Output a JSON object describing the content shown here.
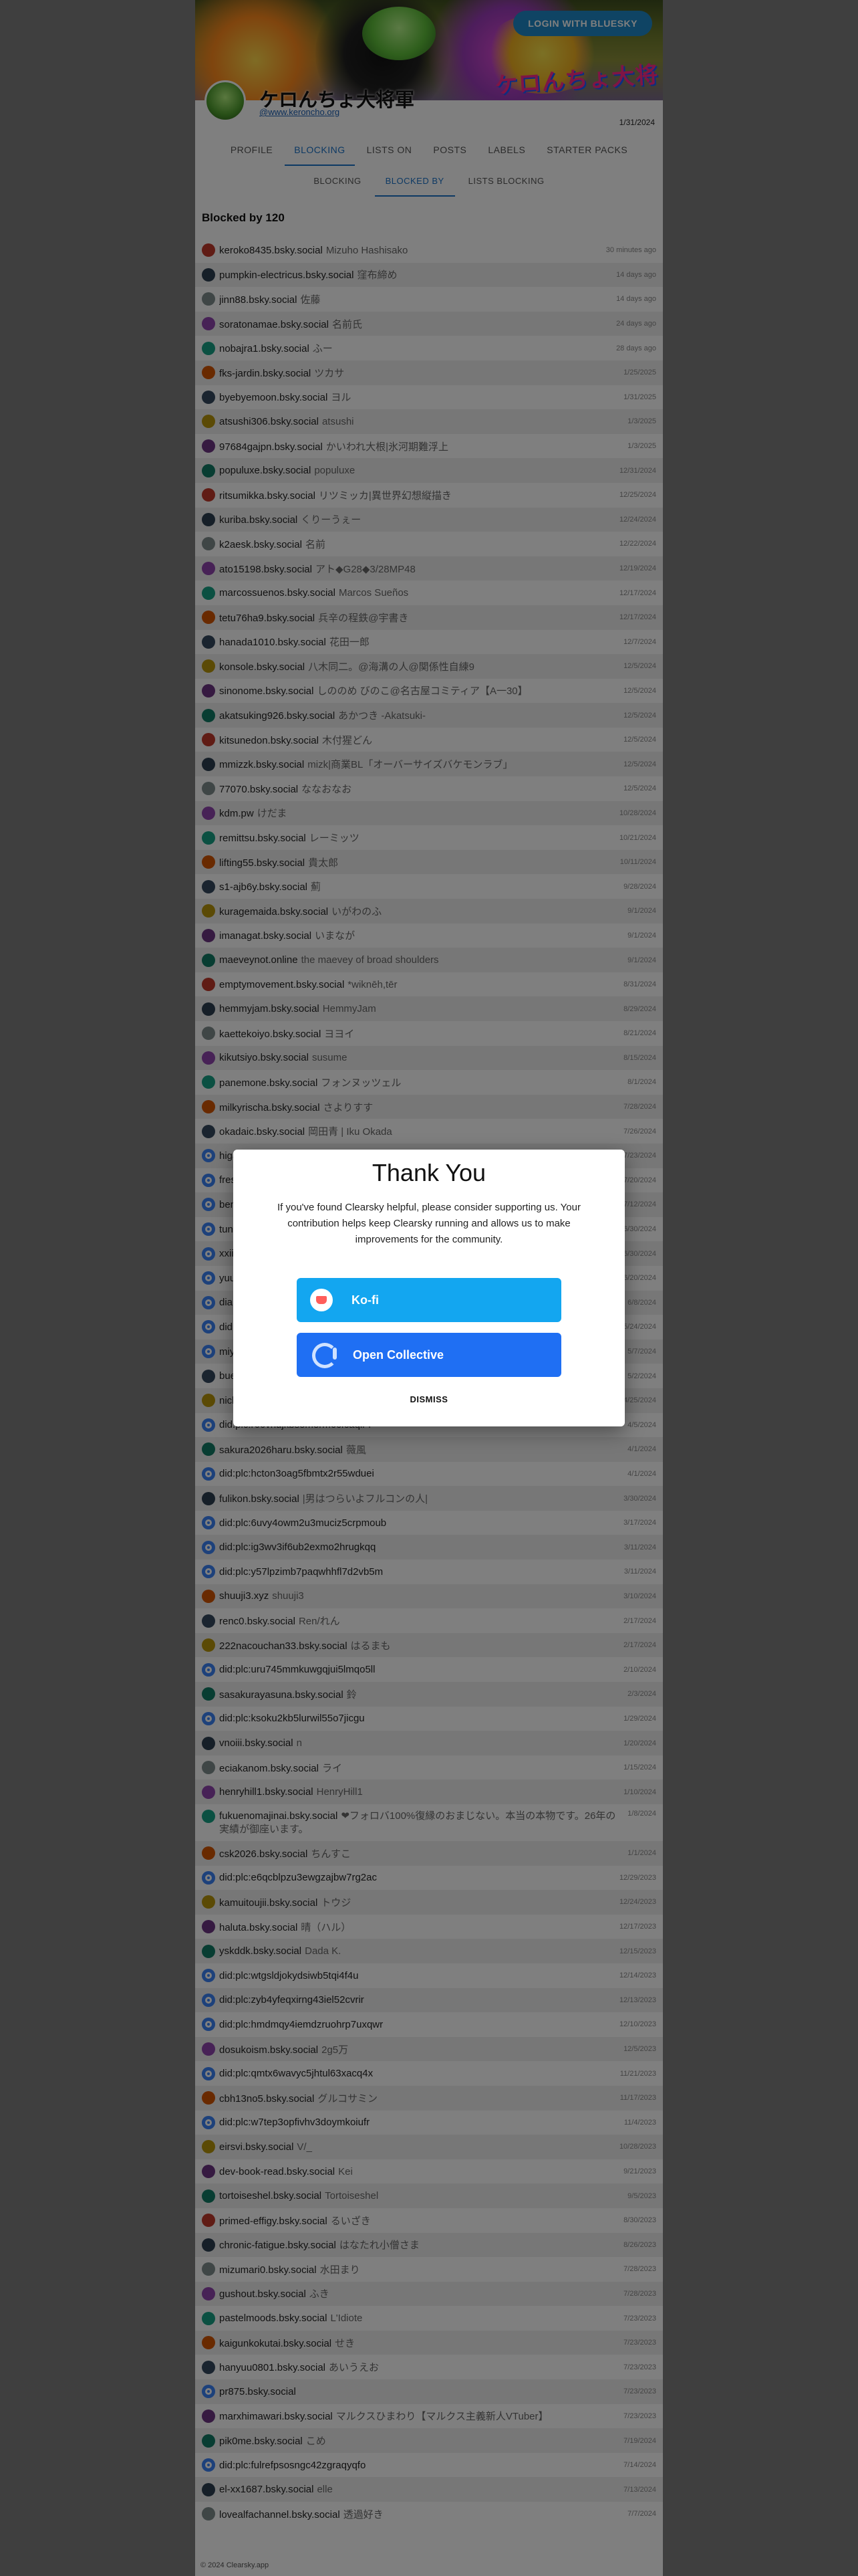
{
  "header": {
    "login_label": "LOGIN WITH BLUESKY",
    "banner_text": "ケロんちょ大将軍"
  },
  "profile": {
    "display_name": "ケロんちょ大将軍",
    "handle": "@www.keroncho.org",
    "joined": "1/31/2024"
  },
  "tabs": [
    "PROFILE",
    "BLOCKING",
    "LISTS ON",
    "POSTS",
    "LABELS",
    "STARTER PACKS"
  ],
  "active_tab": "BLOCKING",
  "subtabs": [
    "BLOCKING",
    "BLOCKED BY",
    "LISTS BLOCKING"
  ],
  "active_subtab": "BLOCKED BY",
  "list_title": "Blocked by 120",
  "rows": [
    {
      "handle": "keroko8435.bsky.social",
      "name": "Mizuho Hashisako",
      "date": "30 minutes ago"
    },
    {
      "handle": "pumpkin-electricus.bsky.social",
      "name": "窪布締め",
      "date": "14 days ago"
    },
    {
      "handle": "jinn88.bsky.social",
      "name": "佐藤",
      "date": "14 days ago"
    },
    {
      "handle": "soratonamae.bsky.social",
      "name": "名前氏",
      "date": "24 days ago"
    },
    {
      "handle": "nobajra1.bsky.social",
      "name": "ふー",
      "date": "28 days ago"
    },
    {
      "handle": "fks-jardin.bsky.social",
      "name": "ツカサ",
      "date": "1/25/2025"
    },
    {
      "handle": "byebyemoon.bsky.social",
      "name": "ヨル",
      "date": "1/31/2025"
    },
    {
      "handle": "atsushi306.bsky.social",
      "name": "atsushi",
      "date": "1/3/2025"
    },
    {
      "handle": "97684gajpn.bsky.social",
      "name": "かいわれ大根|氷河期難浮上",
      "date": "1/3/2025"
    },
    {
      "handle": "populuxe.bsky.social",
      "name": "populuxe",
      "date": "12/31/2024"
    },
    {
      "handle": "ritsumikka.bsky.social",
      "name": "リツミッカ|異世界幻想縦描き",
      "date": "12/25/2024"
    },
    {
      "handle": "kuriba.bsky.social",
      "name": "くりーうぇー",
      "date": "12/24/2024"
    },
    {
      "handle": "k2aesk.bsky.social",
      "name": "名前",
      "date": "12/22/2024"
    },
    {
      "handle": "ato15198.bsky.social",
      "name": "アト◆G28◆3/28MP48",
      "date": "12/19/2024"
    },
    {
      "handle": "marcossuenos.bsky.social",
      "name": "Marcos Sueños",
      "date": "12/17/2024"
    },
    {
      "handle": "tetu76ha9.bsky.social",
      "name": "兵辛の程鉄@宇書き",
      "date": "12/17/2024"
    },
    {
      "handle": "hanada1010.bsky.social",
      "name": "花田一郎",
      "date": "12/7/2024"
    },
    {
      "handle": "konsole.bsky.social",
      "name": "八木同二。@海溝の人@関係性自練9",
      "date": "12/5/2024"
    },
    {
      "handle": "sinonome.bsky.social",
      "name": "しののめ びのこ@名古屋コミティア【A一30】",
      "date": "12/5/2024"
    },
    {
      "handle": "akatsuking926.bsky.social",
      "name": "あかつき -Akatsuki-",
      "date": "12/5/2024"
    },
    {
      "handle": "kitsunedon.bsky.social",
      "name": "木付猩どん",
      "date": "12/5/2024"
    },
    {
      "handle": "mmizzk.bsky.social",
      "name": "mizk|商業BL「オーバーサイズバケモンラブ」",
      "date": "12/5/2024"
    },
    {
      "handle": "77070.bsky.social",
      "name": "ななおなお",
      "date": "12/5/2024"
    },
    {
      "handle": "kdm.pw",
      "name": "けだま",
      "date": "10/28/2024"
    },
    {
      "handle": "remittsu.bsky.social",
      "name": "レーミッツ",
      "date": "10/21/2024"
    },
    {
      "handle": "lifting55.bsky.social",
      "name": "貴太郎",
      "date": "10/11/2024"
    },
    {
      "handle": "s1-ajb6y.bsky.social",
      "name": "薊",
      "date": "9/28/2024"
    },
    {
      "handle": "kuragemaida.bsky.social",
      "name": "いがわのふ",
      "date": "9/1/2024"
    },
    {
      "handle": "imanagat.bsky.social",
      "name": "いまなが",
      "date": "9/1/2024"
    },
    {
      "handle": "maeveynot.online",
      "name": "the maevey of broad shoulders",
      "date": "9/1/2024"
    },
    {
      "handle": "emptymovement.bsky.social",
      "name": "*wiknēh,tēr",
      "date": "8/31/2024"
    },
    {
      "handle": "hemmyjam.bsky.social",
      "name": "HemmyJam",
      "date": "8/29/2024"
    },
    {
      "handle": "kaettekoiyo.bsky.social",
      "name": "ヨヨイ",
      "date": "8/21/2024"
    },
    {
      "handle": "kikutsiyo.bsky.social",
      "name": "susume",
      "date": "8/15/2024"
    },
    {
      "handle": "panemone.bsky.social",
      "name": "フォンヌッツェル",
      "date": "8/1/2024"
    },
    {
      "handle": "milkyrischa.bsky.social",
      "name": "さよりすす",
      "date": "7/28/2024"
    },
    {
      "handle": "okadaic.bsky.social",
      "name": "岡田青 | Iku Okada",
      "date": "7/26/2024"
    },
    {
      "handle": "higahako.bsky.social",
      "name": "",
      "date": "7/23/2024"
    },
    {
      "handle": "fresh-newlook.bsky.social",
      "name": "",
      "date": "7/20/2024"
    },
    {
      "handle": "benifuki.bsky.social",
      "name": "",
      "date": "7/12/2024"
    },
    {
      "handle": "tuno4.bsky.social",
      "name": "",
      "date": "6/30/2024"
    },
    {
      "handle": "xxiioxoiixx.bsky.social",
      "name": "",
      "date": "6/30/2024"
    },
    {
      "handle": "yuu-jin.bsky.social",
      "name": "",
      "date": "6/20/2024"
    },
    {
      "handle": "diamondwater.bsky.social",
      "name": "",
      "date": "6/8/2024"
    },
    {
      "handle": "did:plc:hhau2p3bs",
      "name": "",
      "date": "5/24/2024"
    },
    {
      "handle": "miyatamiri.bsky.social",
      "name": "",
      "date": "5/7/2024"
    },
    {
      "handle": "buehl.jp",
      "name": "Buehl",
      "date": "5/2/2024"
    },
    {
      "handle": "nickeychang.bsky.social",
      "name": "Nickey Chang",
      "date": "4/25/2024"
    },
    {
      "handle": "did:plc:r66vnujkbsomerm6cfcaqlr4",
      "name": "",
      "date": "4/5/2024"
    },
    {
      "handle": "sakura2026haru.bsky.social",
      "name": "薇風",
      "date": "4/1/2024"
    },
    {
      "handle": "did:plc:hcton3oag5fbmtx2r55wduei",
      "name": "",
      "date": "4/1/2024"
    },
    {
      "handle": "fulikon.bsky.social",
      "name": "|男はつらいよフルコンの人|",
      "date": "3/30/2024"
    },
    {
      "handle": "did:plc:6uvy4owm2u3muciz5crpmoub",
      "name": "",
      "date": "3/17/2024"
    },
    {
      "handle": "did:plc:ig3wv3if6ub2exmo2hrugkqq",
      "name": "",
      "date": "3/11/2024"
    },
    {
      "handle": "did:plc:y57lpzimb7paqwhhfl7d2vb5m",
      "name": "",
      "date": "3/11/2024"
    },
    {
      "handle": "shuuji3.xyz",
      "name": "shuuji3",
      "date": "3/10/2024"
    },
    {
      "handle": "renc0.bsky.social",
      "name": "Ren/れん",
      "date": "2/17/2024"
    },
    {
      "handle": "222nacouchan33.bsky.social",
      "name": "はるまも",
      "date": "2/17/2024"
    },
    {
      "handle": "did:plc:uru745mmkuwgqjui5lmqo5ll",
      "name": "",
      "date": "2/10/2024"
    },
    {
      "handle": "sasakurayasuna.bsky.social",
      "name": "鈴",
      "date": "2/3/2024"
    },
    {
      "handle": "did:plc:ksoku2kb5lurwil55o7jicgu",
      "name": "",
      "date": "1/29/2024"
    },
    {
      "handle": "vnoiii.bsky.social",
      "name": "n",
      "date": "1/20/2024"
    },
    {
      "handle": "eciakanom.bsky.social",
      "name": "ライ",
      "date": "1/15/2024"
    },
    {
      "handle": "henryhill1.bsky.social",
      "name": "HenryHill1",
      "date": "1/10/2024"
    },
    {
      "handle": "fukuenomajinai.bsky.social",
      "name": "❤フォロバ100%復縁のおまじない。本当の本物です。26年の実績が御座います。",
      "date": "1/8/2024",
      "tall": true
    },
    {
      "handle": "csk2026.bsky.social",
      "name": "ちんすこ",
      "date": "1/1/2024"
    },
    {
      "handle": "did:plc:e6qcblpzu3ewgzajbw7rg2ac",
      "name": "",
      "date": "12/29/2023"
    },
    {
      "handle": "kamuitoujii.bsky.social",
      "name": "トウジ",
      "date": "12/24/2023"
    },
    {
      "handle": "haluta.bsky.social",
      "name": "晴（ハル）",
      "date": "12/17/2023"
    },
    {
      "handle": "yskddk.bsky.social",
      "name": "Dada K.",
      "date": "12/15/2023"
    },
    {
      "handle": "did:plc:wtgsldjokydsiwb5tqi4f4u",
      "name": "",
      "date": "12/14/2023"
    },
    {
      "handle": "did:plc:zyb4yfeqxirng43iel52cvrir",
      "name": "",
      "date": "12/13/2023"
    },
    {
      "handle": "did:plc:hmdmqy4iemdzruohrp7uxqwr",
      "name": "",
      "date": "12/10/2023"
    },
    {
      "handle": "dosukoism.bsky.social",
      "name": "2g5万",
      "date": "12/5/2023"
    },
    {
      "handle": "did:plc:qmtx6wavyc5jhtul63xacq4x",
      "name": "",
      "date": "11/21/2023"
    },
    {
      "handle": "cbh13no5.bsky.social",
      "name": "グルコサミン",
      "date": "11/17/2023"
    },
    {
      "handle": "did:plc:w7tep3opfivhv3doymkoiufr",
      "name": "",
      "date": "11/4/2023"
    },
    {
      "handle": "eirsvi.bsky.social",
      "name": "V/_",
      "date": "10/28/2023"
    },
    {
      "handle": "dev-book-read.bsky.social",
      "name": "Kei",
      "date": "9/21/2023"
    },
    {
      "handle": "tortoiseshel.bsky.social",
      "name": "Tortoiseshel",
      "date": "9/5/2023"
    },
    {
      "handle": "primed-effigy.bsky.social",
      "name": "るいざき",
      "date": "8/30/2023"
    },
    {
      "handle": "chronic-fatigue.bsky.social",
      "name": "はなたれ小僧さま",
      "date": "8/26/2023"
    },
    {
      "handle": "mizumari0.bsky.social",
      "name": "水田まり",
      "date": "7/28/2023"
    },
    {
      "handle": "gushout.bsky.social",
      "name": "ふき",
      "date": "7/28/2023"
    },
    {
      "handle": "pastelmoods.bsky.social",
      "name": "L'Idiote",
      "date": "7/23/2023"
    },
    {
      "handle": "kaigunkokutai.bsky.social",
      "name": "せき",
      "date": "7/23/2023"
    },
    {
      "handle": "hanyuu0801.bsky.social",
      "name": "あいうえお",
      "date": "7/23/2023"
    },
    {
      "handle": "pr875.bsky.social",
      "name": "",
      "date": "7/23/2023"
    },
    {
      "handle": "marxhimawari.bsky.social",
      "name": "マルクスひまわり【マルクス主義新人VTuber】",
      "date": "7/23/2023"
    },
    {
      "handle": "pik0me.bsky.social",
      "name": "こめ",
      "date": "7/19/2024"
    },
    {
      "handle": "did:plc:fulrefpsosngc42zgraqyqfo",
      "name": "",
      "date": "7/14/2024"
    },
    {
      "handle": "el-xx1687.bsky.social",
      "name": "elle",
      "date": "7/13/2024"
    },
    {
      "handle": "lovealfachannel.bsky.social",
      "name": "透過好き",
      "date": "7/7/2024"
    }
  ],
  "footer": "© 2024 Clearsky.app",
  "modal": {
    "title": "Thank You",
    "body": "If you've found Clearsky helpful, please consider supporting us. Your contribution helps keep Clearsky running and allows us to make improvements for the community.",
    "kofi_label": "Ko-fi",
    "opencollective_label": "Open Collective",
    "dismiss_label": "DISMISS"
  },
  "colors": {
    "accent": "#1a73c8",
    "kofi": "#13a6f0",
    "opencollective": "#1f6ff3",
    "login": "#1e88c8"
  }
}
